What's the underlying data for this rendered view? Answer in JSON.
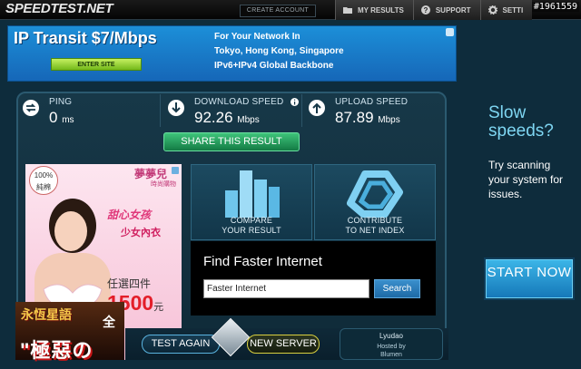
{
  "header": {
    "logo": "SPEEDTEST.NET",
    "create_account": "CREATE ACCOUNT",
    "nav": [
      {
        "label": "MY RESULTS",
        "icon": "folder-icon"
      },
      {
        "label": "SUPPORT",
        "icon": "help-icon"
      },
      {
        "label": "SETTI",
        "icon": "gear-icon"
      }
    ],
    "watermark": "#1961559"
  },
  "banner": {
    "title": "IP Transit $7/Mbps",
    "button": "ENTER SITE",
    "lines": [
      "For Your Network In",
      "Tokyo, Hong Kong, Singapore",
      "IPv6+IPv4 Global Backbone"
    ]
  },
  "metrics": {
    "ping": {
      "label": "PING",
      "value": "0",
      "unit": "ms"
    },
    "download": {
      "label": "DOWNLOAD SPEED",
      "value": "92.26",
      "unit": "Mbps"
    },
    "upload": {
      "label": "UPLOAD SPEED",
      "value": "87.89",
      "unit": "Mbps"
    }
  },
  "share_button": "SHARE THIS RESULT",
  "side_ad": {
    "badge_pct": "100%",
    "badge_text": "純棉",
    "brand": "夢夢兒",
    "brand_sub": "時尚購物",
    "slogan": "甜心女孩",
    "category": "少女內衣",
    "offer": "任選四件",
    "price": "1500",
    "price_unit": "元"
  },
  "game_ad": {
    "title": "永恆星語",
    "sub": "全",
    "line": "\"極惡の"
  },
  "tiles": {
    "compare": {
      "line1": "COMPARE",
      "line2": "YOUR RESULT"
    },
    "contribute": {
      "line1": "CONTRIBUTE",
      "line2": "TO NET INDEX"
    }
  },
  "find_faster": {
    "title": "Find Faster Internet",
    "input_value": "Faster Internet",
    "button": "Search"
  },
  "bottom": {
    "test_again": "TEST AGAIN",
    "new_server": "NEW SERVER",
    "server_name": "Lyudao",
    "hosted_by": "Hosted by",
    "host": "Blumen"
  },
  "right": {
    "slow": "Slow speeds?",
    "scan": "Try scanning your system for issues.",
    "start": "START NOW"
  },
  "colors": {
    "background": "#0e2c3c",
    "accent_green": "#137a44",
    "accent_blue": "#1577b8",
    "cyan_text": "#7ed6f2"
  }
}
